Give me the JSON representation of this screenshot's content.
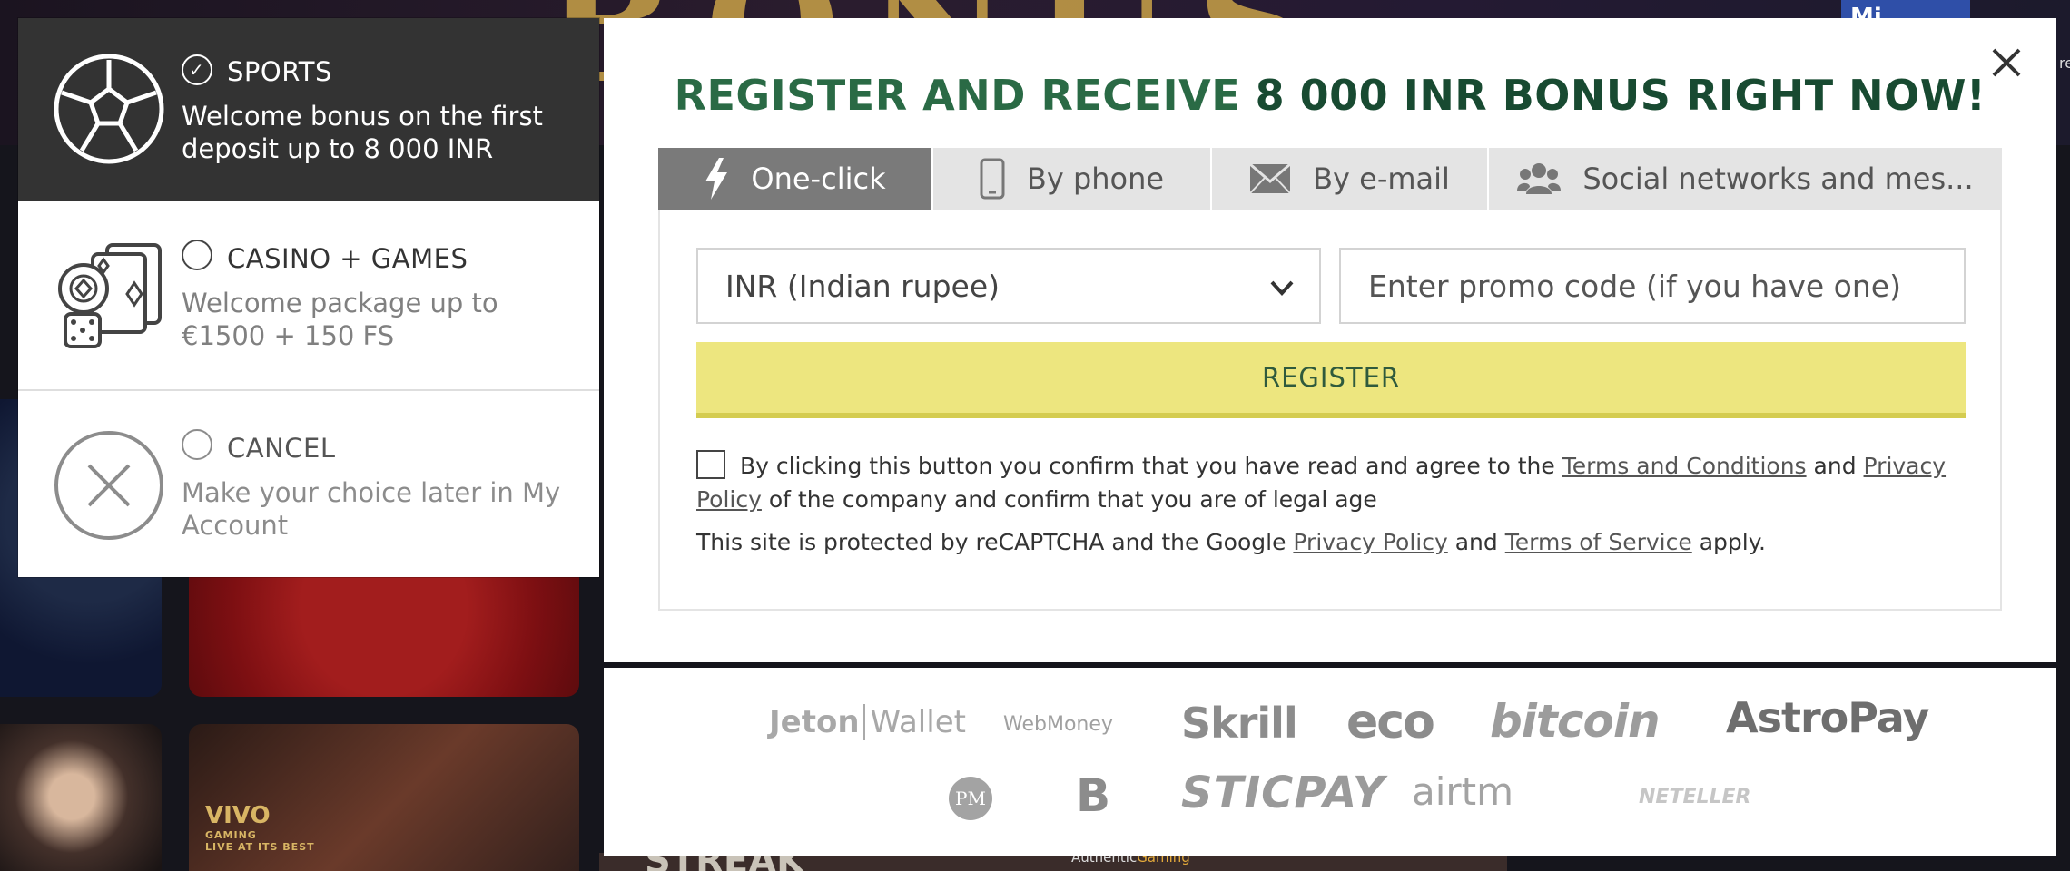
{
  "background": {
    "blue_chip_text": "Mi",
    "right_edge_text": "ree",
    "vivo_brand": "VIVO",
    "vivo_sub": "GAMING",
    "vivo_tag": "LIVE AT ITS BEST",
    "bottom_text_left": "STREAK",
    "bottom_text_right_prefix": "Authentic",
    "bottom_text_right_suffix": "Gaming"
  },
  "bonus_choices": [
    {
      "title": "SPORTS",
      "description": "Welcome bonus on the first deposit up to 8 000 INR",
      "selected": true,
      "icon": "soccer-ball-icon"
    },
    {
      "title": "CASINO + GAMES",
      "description": "Welcome package up to €1500 + 150 FS",
      "selected": false,
      "icon": "casino-cards-dice-icon"
    },
    {
      "title": "CANCEL",
      "description": "Make your choice later in My Account",
      "selected": false,
      "icon": "cancel-x-icon"
    }
  ],
  "modal": {
    "headline_prefix": "REGISTER AND RECEIVE",
    "headline_amount": "8 000 INR BONUS RIGHT NOW!",
    "close_icon": "close-icon",
    "tabs": [
      {
        "label": "One-click",
        "icon": "lightning-icon",
        "active": true
      },
      {
        "label": "By phone",
        "icon": "phone-icon",
        "active": false
      },
      {
        "label": "By e-mail",
        "icon": "envelope-icon",
        "active": false
      },
      {
        "label": "Social networks and mes...",
        "icon": "people-icon",
        "active": false
      }
    ],
    "currency_select": "INR (Indian rupee)",
    "promo_placeholder": "Enter promo code (if you have one)",
    "register_label": "REGISTER",
    "agree": {
      "text_1": "By clicking this button you confirm that you have read and agree to the",
      "terms_link": "Terms and Conditions",
      "text_2": "and",
      "privacy_link": "Privacy Policy",
      "text_3": "of the company and confirm that you are of legal age"
    },
    "captcha": {
      "text_1": "This site is protected by reCAPTCHA and the Google",
      "privacy_link": "Privacy Policy",
      "text_2": "and",
      "terms_link": "Terms of Service",
      "text_3": "apply."
    },
    "colors": {
      "headline": "#2a6a45",
      "register_bg": "#ede67f",
      "active_tab": "#7a7a7a"
    }
  },
  "payments": {
    "jeton": "Jeton",
    "jeton_wallet": "Wallet",
    "webmoney": "WebMoney",
    "skrill": "Skrill",
    "eco": "eco",
    "bitcoin": "bitcoin",
    "astropay": "AstroPay",
    "pm": "PM",
    "b": "B",
    "sticpay": "STICPAY",
    "airtm": "airtm",
    "neteller": "NETELLER"
  }
}
